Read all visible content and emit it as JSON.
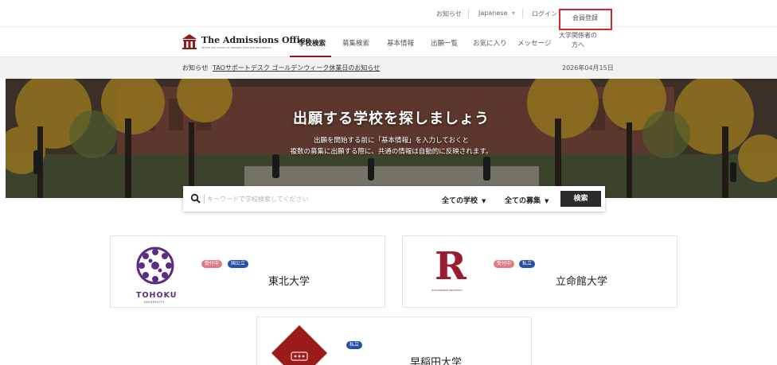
{
  "util": {
    "news": "お知らせ",
    "language": "Japanese",
    "login": "ログイン",
    "register": "会員登録"
  },
  "brand": {
    "name": "The Admissions Office",
    "tagline": "Where the choice of colleges from the Admissions"
  },
  "nav": {
    "items": [
      "学校検索",
      "募集検索",
      "基本情報",
      "出願一覧",
      "お気に入り",
      "メッセージ"
    ],
    "staff": "大学関係者の方へ"
  },
  "notice": {
    "label": "お知らせ",
    "text": "TAOサポートデスク ゴールデンウィーク休業日のお知らせ",
    "date": "2026年04月15日"
  },
  "hero": {
    "title": "出願する学校を探しましょう",
    "line1": "出願を開始する前に「基本情報」を入力しておくと",
    "line2": "複数の募集に出願する際に、共通の情報は自動的に反映されます。"
  },
  "search": {
    "placeholder": "キーワードで学校検索してください",
    "school_filter": "全ての学校",
    "recruit_filter": "全ての募集",
    "button": "検索"
  },
  "schools": [
    {
      "name": "東北大学",
      "badges": [
        "受付中",
        "国公立"
      ],
      "logo_text": "TOHOKU",
      "logo_sub": "UNIVERSITY"
    },
    {
      "name": "立命館大学",
      "badges": [
        "受付中",
        "私立"
      ],
      "logo_text": "R",
      "logo_sub": "RITSUMEIKAN UNIVERSITY"
    },
    {
      "name": "早稲田大学",
      "badges": [
        "私立"
      ]
    }
  ],
  "colors": {
    "brand_red": "#8b1a1a",
    "highlight": "#d9262c",
    "badge_open": "#e07a82",
    "badge_type": "#2450a8",
    "tohoku_purple": "#5a2d82",
    "ritsumeikan": "#9b1b30",
    "waseda": "#9b1b1b"
  },
  "icons": [
    "logo-building-icon",
    "search-icon",
    "chevron-down-icon"
  ]
}
